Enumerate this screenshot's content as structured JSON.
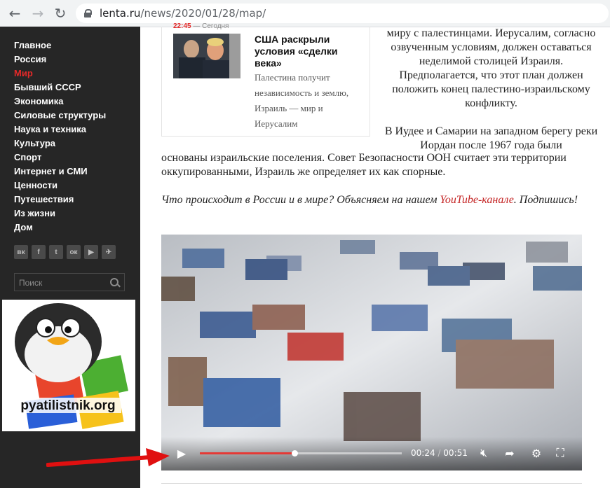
{
  "browser": {
    "url_host": "lenta.ru",
    "url_path": "/news/2020/01/28/map/",
    "icons": [
      "back-arrow-icon",
      "forward-arrow-icon",
      "reload-icon",
      "lock-icon"
    ]
  },
  "sidebar": {
    "menu": [
      {
        "label": "Главное",
        "active": false
      },
      {
        "label": "Россия",
        "active": false
      },
      {
        "label": "Мир",
        "active": true
      },
      {
        "label": "Бывший СССР",
        "active": false
      },
      {
        "label": "Экономика",
        "active": false
      },
      {
        "label": "Силовые структуры",
        "active": false
      },
      {
        "label": "Наука и техника",
        "active": false
      },
      {
        "label": "Культура",
        "active": false
      },
      {
        "label": "Спорт",
        "active": false
      },
      {
        "label": "Интернет и СМИ",
        "active": false
      },
      {
        "label": "Ценности",
        "active": false
      },
      {
        "label": "Путешествия",
        "active": false
      },
      {
        "label": "Из жизни",
        "active": false
      },
      {
        "label": "Дом",
        "active": false
      }
    ],
    "socials": [
      {
        "icon": "vk-icon",
        "glyph": "вк"
      },
      {
        "icon": "facebook-icon",
        "glyph": "f"
      },
      {
        "icon": "twitter-icon",
        "glyph": "t"
      },
      {
        "icon": "odnoklassniki-icon",
        "glyph": "ок"
      },
      {
        "icon": "youtube-icon",
        "glyph": "▶"
      },
      {
        "icon": "telegram-icon",
        "glyph": "✈"
      }
    ],
    "search_placeholder": "Поиск",
    "logo_text": "pyatilistnik.org"
  },
  "card": {
    "time": "22:45",
    "date": "Сегодня",
    "title": "США раскрыли условия «сделки века»",
    "desc": "Палестина получит независимость и землю, Израиль — мир и Иерусалим"
  },
  "article": {
    "right_p1": "миру с палестинцами. Иерусалим, согласно озвученным условиям, должен оставаться неделимой столицей Израиля. Предполагается, что этот план должен положить конец палестино-израильскому конфликту.",
    "right_p2": "В Иудее и Самарии на западном берегу реки Иордан после 1967 года были",
    "full_text": "основаны израильские поселения. Совет Безопасности ООН считает эти территории оккупированными, Израиль же определяет их как спорные.",
    "promo_pre": "Что происходит в России и в мире? Объясняем на нашем ",
    "promo_link": "YouTube-канале",
    "promo_post": ". Подпишись!"
  },
  "video": {
    "current_time": "00:24",
    "separator": "/",
    "duration": "00:51",
    "progress": 0.47,
    "controls": [
      "play-icon",
      "mute-icon",
      "share-icon",
      "settings-icon",
      "fullscreen-icon"
    ]
  },
  "colors": {
    "accent": "#e42929",
    "sidebar_bg": "#262626",
    "link": "#c42222",
    "progress": "#e53935"
  }
}
